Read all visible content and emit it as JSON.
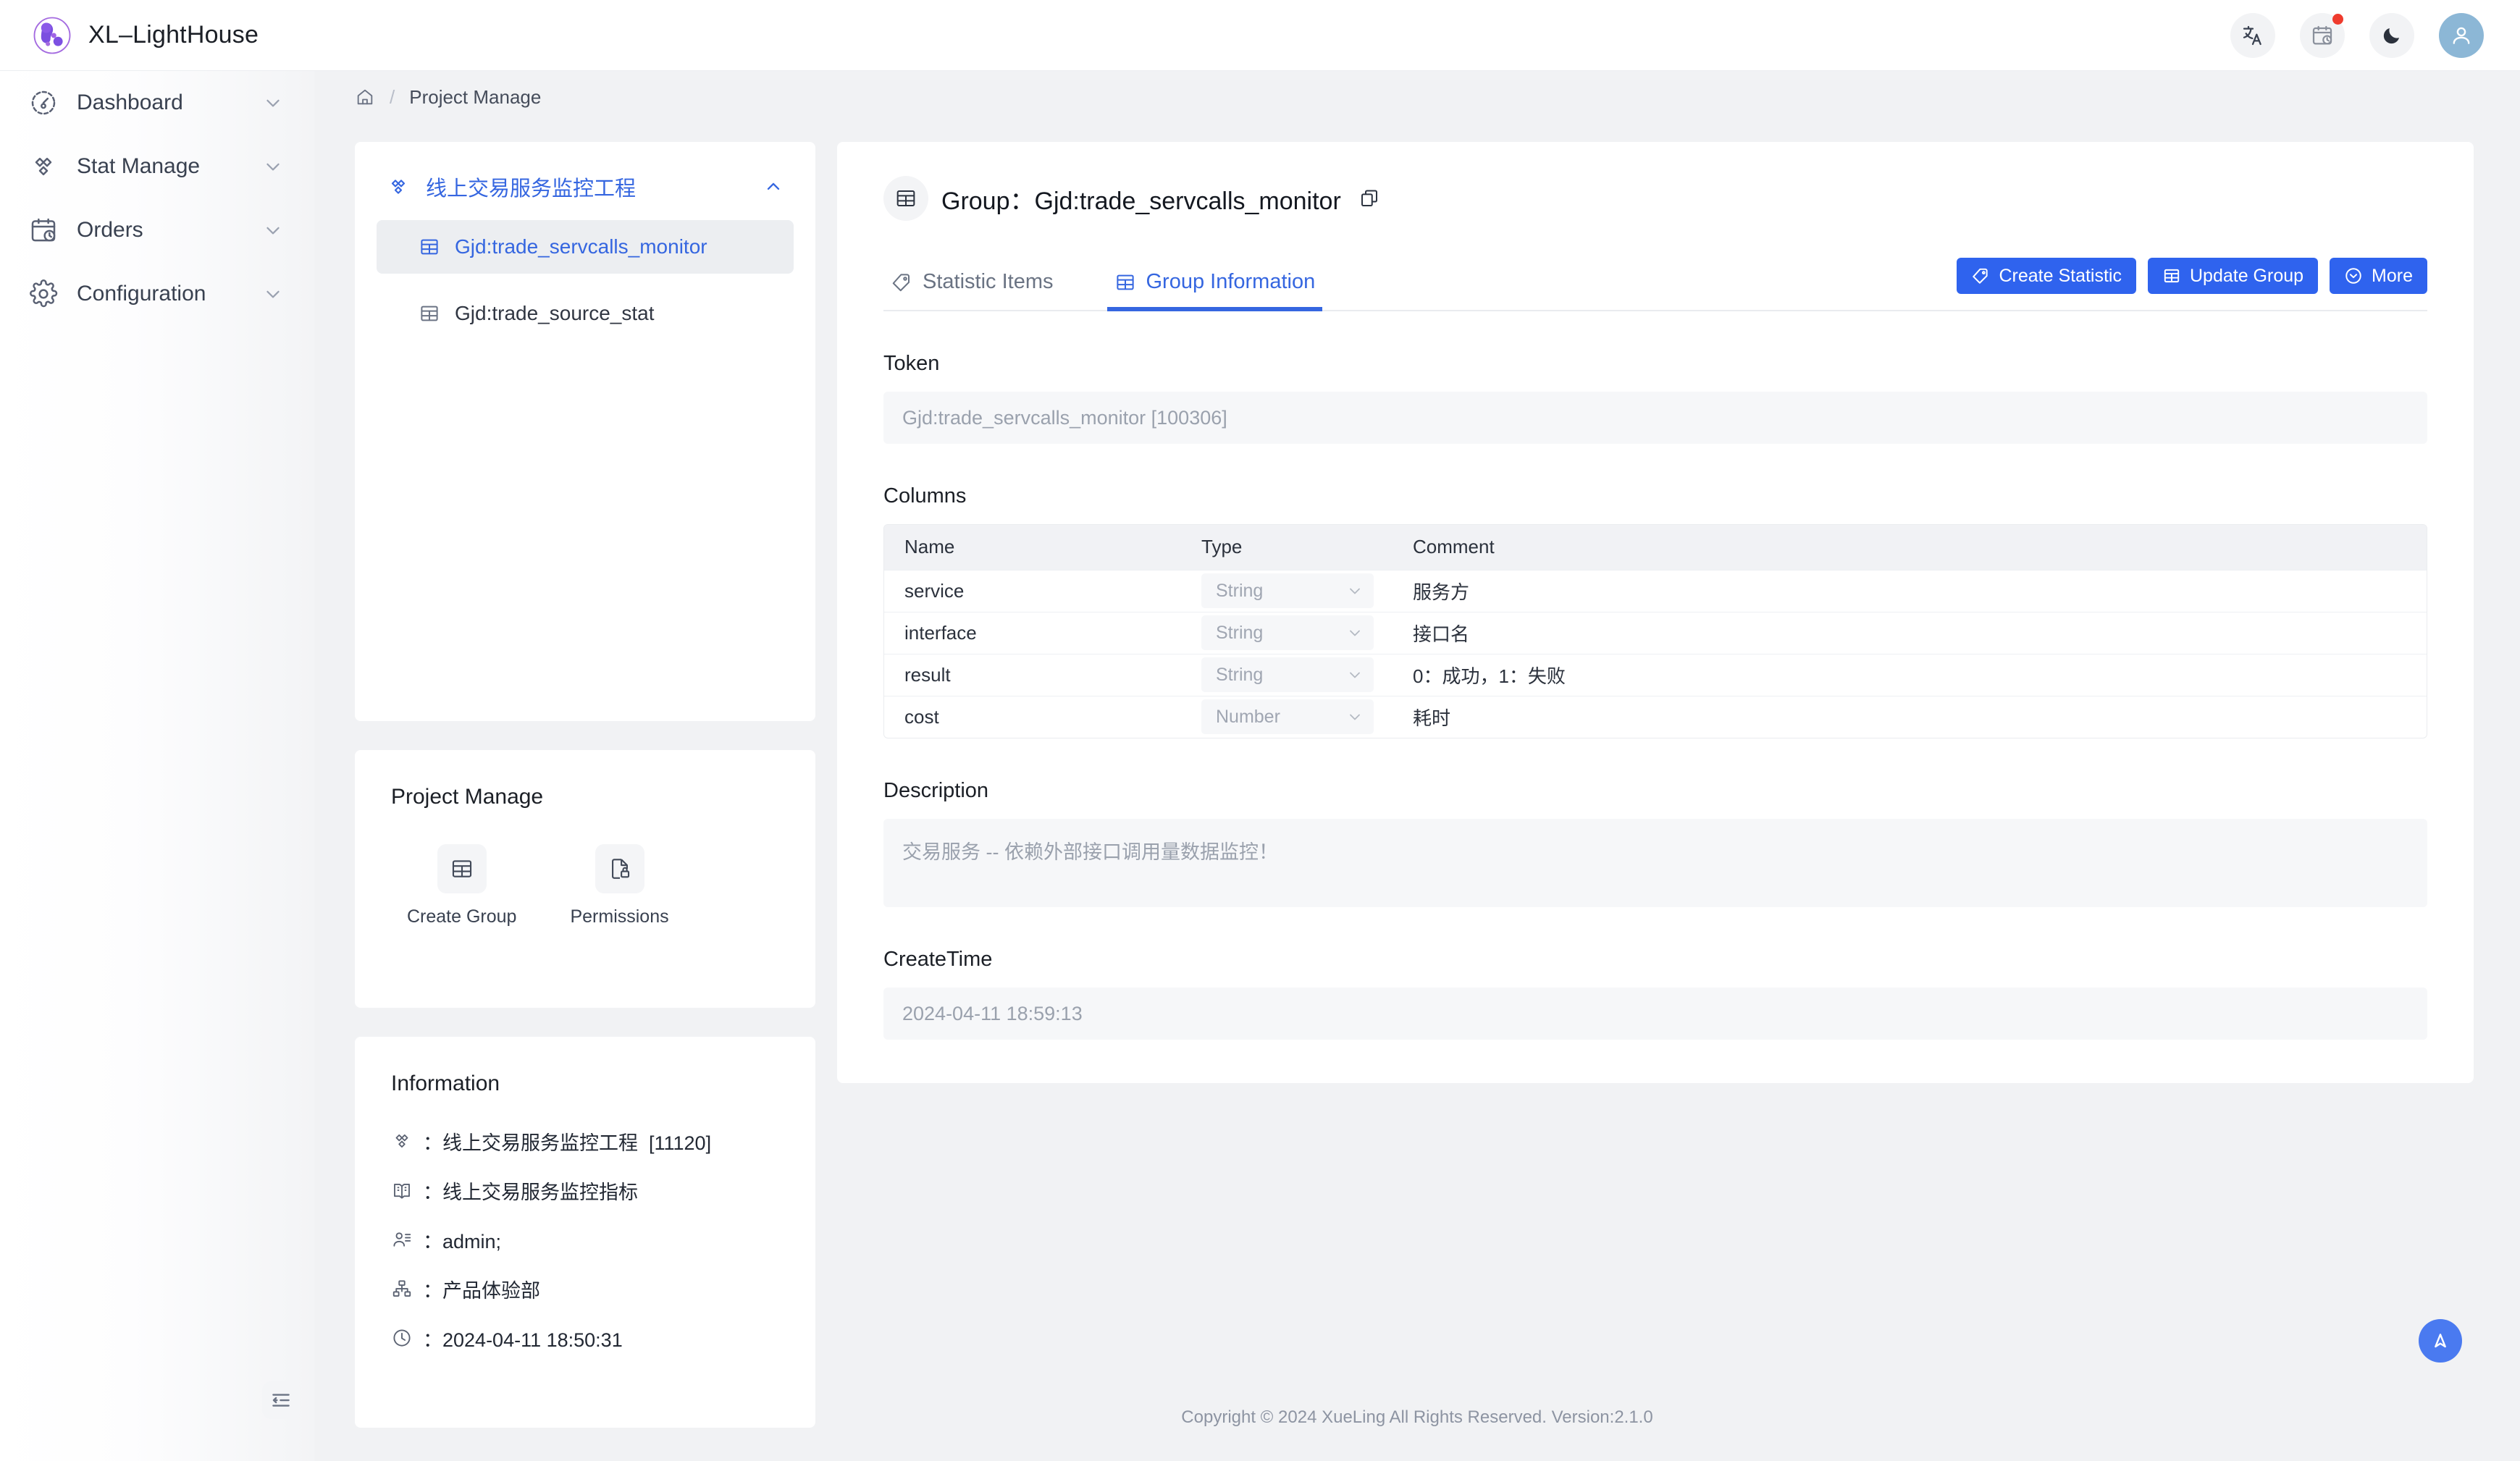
{
  "app": {
    "brand_name": "XL–LightHouse",
    "header_icons": [
      "translate-icon",
      "calendar-clock-icon",
      "moon-icon",
      "user-avatar-icon"
    ]
  },
  "sidebar": {
    "items": [
      {
        "label": "Dashboard",
        "icon": "dashboard-gauge-icon"
      },
      {
        "label": "Stat Manage",
        "icon": "stat-diamond-icon"
      },
      {
        "label": "Orders",
        "icon": "calendar-clock-icon"
      },
      {
        "label": "Configuration",
        "icon": "gear-icon"
      }
    ],
    "collapse_icon": "collapse-menu-icon"
  },
  "breadcrumb": {
    "home_icon": "home-icon",
    "separator": "/",
    "current": "Project Manage"
  },
  "tree": {
    "root_label": "线上交易服务监控工程",
    "root_icon": "stat-diamond-icon",
    "caret_icon": "chevron-up-icon",
    "children": [
      {
        "label": "Gjd:trade_servcalls_monitor",
        "icon": "table-icon",
        "active": true
      },
      {
        "label": "Gjd:trade_source_stat",
        "icon": "table-icon",
        "active": false
      }
    ]
  },
  "project_manage_card": {
    "title": "Project Manage",
    "actions": [
      {
        "label": "Create Group",
        "icon": "table-icon"
      },
      {
        "label": "Permissions",
        "icon": "document-lock-icon"
      }
    ]
  },
  "information_card": {
    "title": "Information",
    "rows": [
      {
        "icon": "stat-diamond-icon",
        "text": "：线上交易服务监控工程  [11120]"
      },
      {
        "icon": "book-icon",
        "text": "：线上交易服务监控指标"
      },
      {
        "icon": "users-icon",
        "text": "：admin;"
      },
      {
        "icon": "org-tree-icon",
        "text": "：产品体验部"
      },
      {
        "icon": "clock-icon",
        "text": "：2024-04-11 18:50:31"
      }
    ]
  },
  "main": {
    "group_icon": "table-icon",
    "group_title": "Group：Gjd:trade_servcalls_monitor",
    "copy_icon": "copy-icon",
    "tabs": [
      {
        "label": "Statistic Items",
        "icon": "tag-icon",
        "active": false
      },
      {
        "label": "Group Information",
        "icon": "table-icon",
        "active": true
      }
    ],
    "buttons": [
      {
        "label": "Create Statistic",
        "icon": "tag-icon"
      },
      {
        "label": "Update Group",
        "icon": "table-icon"
      },
      {
        "label": "More",
        "icon": "circle-chevron-down-icon"
      }
    ],
    "token": {
      "label": "Token",
      "value": "Gjd:trade_servcalls_monitor [100306]"
    },
    "columns": {
      "label": "Columns",
      "headers": [
        "Name",
        "Type",
        "Comment"
      ],
      "rows": [
        {
          "name": "service",
          "type": "String",
          "comment": "服务方"
        },
        {
          "name": "interface",
          "type": "String",
          "comment": "接口名"
        },
        {
          "name": "result",
          "type": "String",
          "comment": "0：成功，1：失败"
        },
        {
          "name": "cost",
          "type": "Number",
          "comment": "耗时"
        }
      ]
    },
    "description": {
      "label": "Description",
      "value": "交易服务 -- 依赖外部接口调用量数据监控！"
    },
    "create_time": {
      "label": "CreateTime",
      "value": "2024-04-11 18:59:13"
    }
  },
  "footer": {
    "text": "Copyright © 2024 XueLing All Rights Reserved.    Version:2.1.0"
  },
  "fab": {
    "icon": "scroll-top-arrow-icon"
  },
  "colors": {
    "primary": "#2f63ee",
    "link": "#3566e0",
    "badge": "#ef3b2d",
    "avatar_bg": "#8cb7d6"
  }
}
